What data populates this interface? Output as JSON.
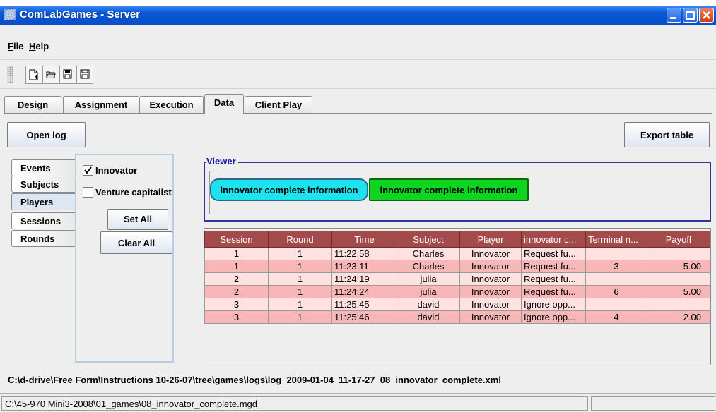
{
  "window": {
    "title": "ComLabGames - Server"
  },
  "menu": {
    "file": "File",
    "help": "Help"
  },
  "toolbar": {
    "icons": [
      "new-icon",
      "open-icon",
      "save-as-icon",
      "save-icon"
    ]
  },
  "tabs": [
    "Design",
    "Assignment",
    "Execution",
    "Data",
    "Client Play"
  ],
  "selected_tab": "Data",
  "buttons": {
    "open_log": "Open log",
    "export_table": "Export table",
    "set_all": "Set All",
    "clear_all": "Clear All"
  },
  "side_tabs": [
    "Events",
    "Subjects",
    "Players",
    "Sessions",
    "Rounds"
  ],
  "selected_side_tab": "Players",
  "players": [
    {
      "label": "Innovator",
      "checked": true
    },
    {
      "label": "Venture capitalist",
      "checked": false
    }
  ],
  "viewer": {
    "label": "Viewer",
    "items": [
      "innovator complete information",
      "innovator complete information"
    ]
  },
  "table": {
    "columns": [
      "Session",
      "Round",
      "Time",
      "Subject",
      "Player",
      "innovator c...",
      "Terminal n...",
      "Payoff"
    ],
    "rows": [
      [
        "1",
        "1",
        "11:22:58",
        "Charles",
        "Innovator",
        "Request fu...",
        "",
        ""
      ],
      [
        "1",
        "1",
        "11:23:11",
        "Charles",
        "Innovator",
        "Request fu...",
        "3",
        "5.00"
      ],
      [
        "2",
        "1",
        "11:24:19",
        "julia",
        "Innovator",
        "Request fu...",
        "",
        ""
      ],
      [
        "2",
        "1",
        "11:24:24",
        "julia",
        "Innovator",
        "Request fu...",
        "6",
        "5.00"
      ],
      [
        "3",
        "1",
        "11:25:45",
        "david",
        "Innovator",
        "Ignore opp...",
        "",
        ""
      ],
      [
        "3",
        "1",
        "11:25:46",
        "david",
        "Innovator",
        "Ignore opp...",
        "4",
        "2.00"
      ]
    ]
  },
  "log_path": "C:\\d-drive\\Free Form\\Instructions 10-26-07\\tree\\games\\logs\\log_2009-01-04_11-17-27_08_innovator_complete.xml",
  "status_path": "C:\\45-970 Mini3-2008\\01_games\\08_innovator_complete.mgd",
  "colors": {
    "titlebar": "#0552cf",
    "table_header": "#a44a4a",
    "row_light": "#ffe1e1",
    "row_dark": "#f7b7b7",
    "pill_cyan": "#1ee3ee",
    "pill_green": "#10d520",
    "viewer_border": "#333399"
  }
}
